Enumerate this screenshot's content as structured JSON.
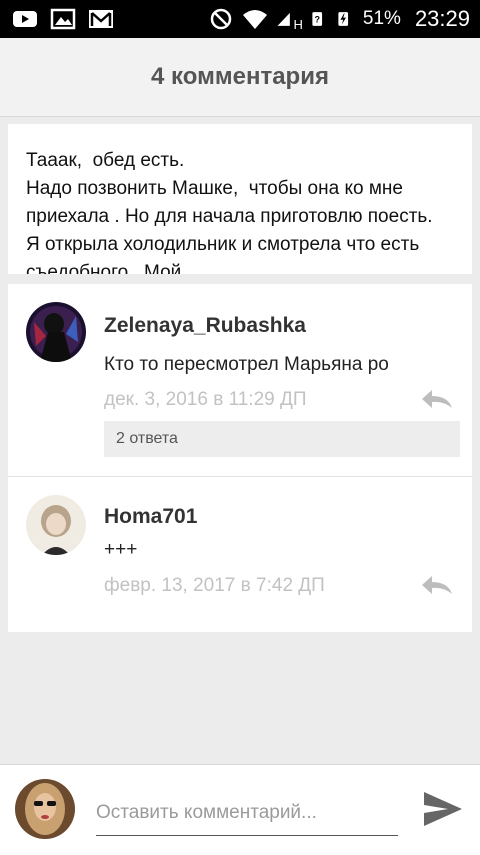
{
  "status_bar": {
    "battery_percent": "51%",
    "time": "23:29",
    "network_label": "H",
    "icons": [
      "youtube-icon",
      "gallery-icon",
      "gmail-icon",
      "do-not-disturb-icon",
      "wifi-icon",
      "signal-icon",
      "sim-unknown-icon",
      "charging-icon"
    ]
  },
  "header": {
    "title": "4 комментария"
  },
  "post": {
    "excerpt": "Тааак,  обед есть.\nНадо позвонить Машке,  чтобы она ко мне приехала . Но для начала приготовлю поесть.  Я открыла холодильник и смотрела что есть съедобного.  Мой"
  },
  "comments": [
    {
      "author": "Zelenaya_Rubashka",
      "text": "Кто то пересмотрел Марьяна ро",
      "date": "дек. 3, 2016 в 11:29 ДП",
      "replies_label": "2 ответа"
    },
    {
      "author": "Homa701",
      "text": "+++",
      "date": "февр. 13, 2017 в 7:42 ДП"
    }
  ],
  "input": {
    "placeholder": "Оставить комментарий..."
  },
  "colors": {
    "background": "#ececec",
    "card": "#ffffff",
    "date_text": "#c2c2c2",
    "header_text": "#555555"
  }
}
